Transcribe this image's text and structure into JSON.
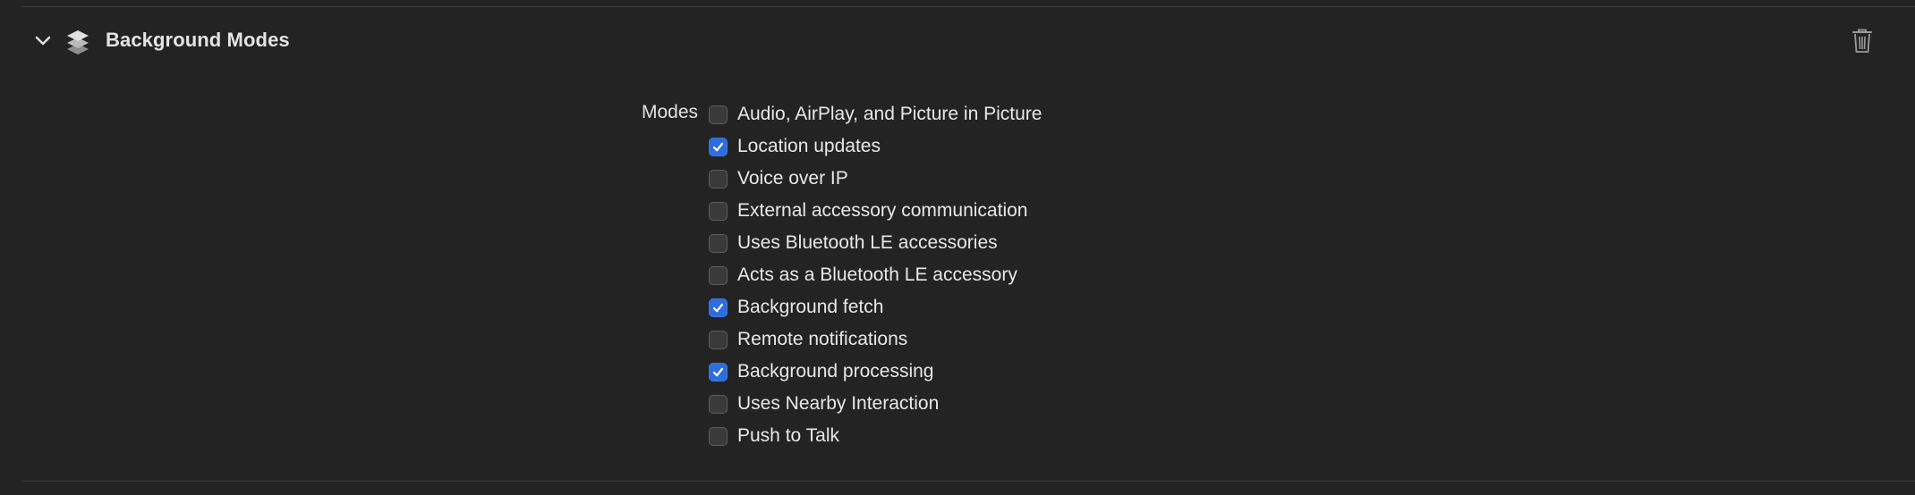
{
  "section": {
    "title": "Background Modes",
    "icons": {
      "collapse": "chevron-down-icon",
      "capability": "layers-icon",
      "delete": "trash-icon"
    }
  },
  "modes": {
    "label": "Modes",
    "items": [
      {
        "label": "Audio, AirPlay, and Picture in Picture",
        "checked": false
      },
      {
        "label": "Location updates",
        "checked": true
      },
      {
        "label": "Voice over IP",
        "checked": false
      },
      {
        "label": "External accessory communication",
        "checked": false
      },
      {
        "label": "Uses Bluetooth LE accessories",
        "checked": false
      },
      {
        "label": "Acts as a Bluetooth LE accessory",
        "checked": false
      },
      {
        "label": "Background fetch",
        "checked": true
      },
      {
        "label": "Remote notifications",
        "checked": false
      },
      {
        "label": "Background processing",
        "checked": true
      },
      {
        "label": "Uses Nearby Interaction",
        "checked": false
      },
      {
        "label": "Push to Talk",
        "checked": false
      }
    ]
  },
  "colors": {
    "background": "#232323",
    "checkbox_accent": "#2f6ce0",
    "divider": "#3c3c3c"
  }
}
